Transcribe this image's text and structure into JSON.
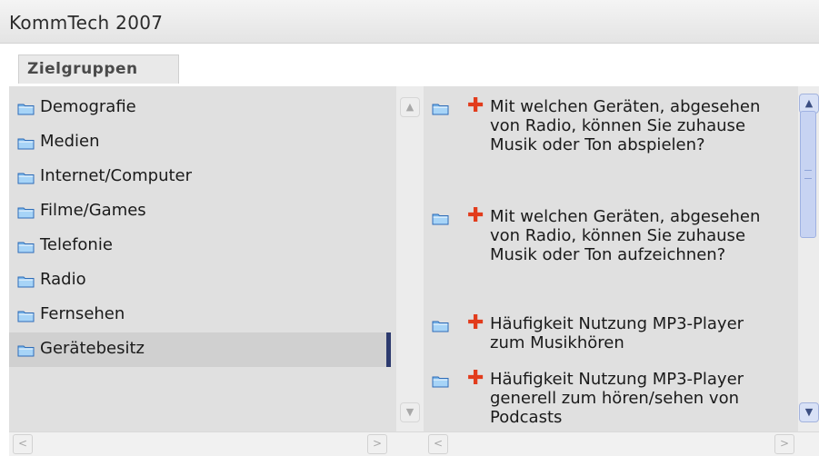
{
  "window": {
    "title": "KommTech 2007"
  },
  "tabs": [
    {
      "label": "Zielgruppen",
      "active": true
    }
  ],
  "left_panel": {
    "items": [
      {
        "label": "Demografie",
        "icon": "folder-icon",
        "selected": false
      },
      {
        "label": "Medien",
        "icon": "folder-icon",
        "selected": false
      },
      {
        "label": "Internet/Computer",
        "icon": "folder-icon",
        "selected": false
      },
      {
        "label": "Filme/Games",
        "icon": "folder-icon",
        "selected": false
      },
      {
        "label": "Telefonie",
        "icon": "folder-icon",
        "selected": false
      },
      {
        "label": "Radio",
        "icon": "folder-icon",
        "selected": false
      },
      {
        "label": "Fernsehen",
        "icon": "folder-icon",
        "selected": false
      },
      {
        "label": "Gerätebesitz",
        "icon": "folder-icon",
        "selected": true
      }
    ]
  },
  "right_panel": {
    "items": [
      {
        "label": "Mit welchen Geräten, abgesehen von Radio, können Sie zuhause Musik oder Ton abspielen?",
        "icon": "folder-icon",
        "action": "plus-icon"
      },
      {
        "label": "Mit welchen Geräten, abgesehen von Radio, können Sie zuhause Musik oder Ton aufzeichnen?",
        "icon": "folder-icon",
        "action": "plus-icon"
      },
      {
        "label": "Häufigkeit Nutzung MP3-Player zum Musikhören",
        "icon": "folder-icon",
        "action": "plus-icon"
      },
      {
        "label": "Häufigkeit Nutzung MP3-Player generell zum hören/sehen von Podcasts",
        "icon": "folder-icon",
        "action": "plus-icon"
      }
    ]
  },
  "scroll_icons": {
    "up": "▲",
    "down": "▼",
    "left": "<",
    "right": ">"
  },
  "colors": {
    "panel_bg": "#e0e0e0",
    "selected_bg": "#d0d0d0",
    "selection_marker": "#2c3a6e",
    "plus": "#e23c1c",
    "folder": "#4a8fd8",
    "scroll_thumb": "#c7d3f2"
  }
}
